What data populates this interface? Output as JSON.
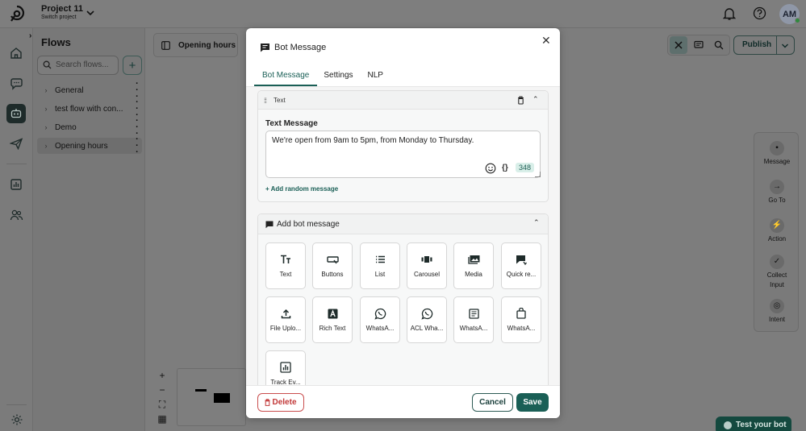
{
  "header": {
    "project_name": "Project 11",
    "project_sub": "Switch project",
    "avatar_initials": "AM"
  },
  "flows": {
    "title": "Flows",
    "search_placeholder": "Search flows...",
    "items": [
      {
        "label": "General"
      },
      {
        "label": "test flow with con..."
      },
      {
        "label": "Demo"
      },
      {
        "label": "Opening hours"
      }
    ]
  },
  "canvas": {
    "open_tab_label": "Opening hours",
    "publish_label": "Publish",
    "test_bot_label": "Test your bot",
    "right_panel": [
      {
        "label": "Message",
        "icon": "message-icon"
      },
      {
        "label": "Go To",
        "icon": "arrow-right-icon"
      },
      {
        "label": "Action",
        "icon": "bolt-icon"
      },
      {
        "label": "Collect Input",
        "icon": "check-icon"
      },
      {
        "label": "Intent",
        "icon": "target-icon"
      }
    ]
  },
  "modal": {
    "title": "Bot Message",
    "tabs": [
      "Bot Message",
      "Settings",
      "NLP"
    ],
    "text_card": {
      "title": "Text",
      "field_label": "Text Message",
      "value": "We're open from 9am to 5pm, from Monday to Thursday.",
      "char_count": "348",
      "add_random": "+ Add random message"
    },
    "add_card": {
      "title": "Add bot message",
      "tiles": [
        {
          "label": "Text",
          "icon": "text-icon"
        },
        {
          "label": "Buttons",
          "icon": "buttons-icon"
        },
        {
          "label": "List",
          "icon": "list-icon"
        },
        {
          "label": "Carousel",
          "icon": "carousel-icon"
        },
        {
          "label": "Media",
          "icon": "media-icon"
        },
        {
          "label": "Quick re...",
          "icon": "quick-reply-icon"
        },
        {
          "label": "File Uplo...",
          "icon": "upload-icon"
        },
        {
          "label": "Rich Text",
          "icon": "rich-text-icon"
        },
        {
          "label": "WhatsA...",
          "icon": "whatsapp-icon"
        },
        {
          "label": "ACL Wha...",
          "icon": "whatsapp-icon"
        },
        {
          "label": "WhatsA...",
          "icon": "whatsapp-form-icon"
        },
        {
          "label": "WhatsA...",
          "icon": "whatsapp-bag-icon"
        },
        {
          "label": "Track Ev...",
          "icon": "chart-icon"
        }
      ]
    },
    "footer": {
      "delete_label": "Delete",
      "cancel_label": "Cancel",
      "save_label": "Save"
    }
  },
  "colors": {
    "accent": "#1a5f56",
    "danger": "#c23838",
    "overlay": "#7d7d7d"
  }
}
